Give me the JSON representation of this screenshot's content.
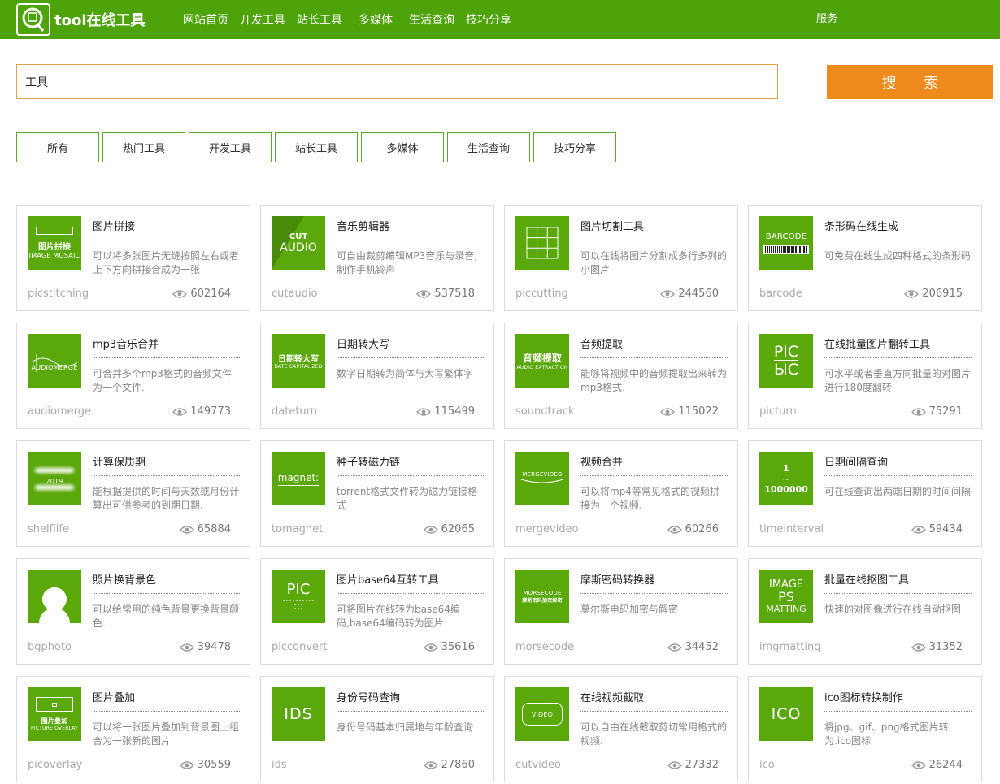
{
  "header": {
    "logo_text": "tool在线工具",
    "nav": [
      "网站首页",
      "开发工具",
      "站长工具",
      "多媒体",
      "生活查询",
      "技巧分享"
    ],
    "service": "服务",
    "bg_color": "#4ea20a"
  },
  "search": {
    "value": "工具",
    "button_label": "搜 索"
  },
  "filters": [
    "所有",
    "热门工具",
    "开发工具",
    "站长工具",
    "多媒体",
    "生活查询",
    "技巧分享"
  ],
  "cards": [
    {
      "title": "图片拼接",
      "desc": "可以将多张图片无缝按照左右或者上下方向拼接合成为一张",
      "slug": "picstitching",
      "views": "602164",
      "icon": "image-mosaic-icon",
      "thumb": [
        "图片拼接",
        "IMAGE MOSAIC"
      ]
    },
    {
      "title": "音乐剪辑器",
      "desc": "可自由裁剪编辑MP3音乐与录音,制作手机铃声",
      "slug": "cutaudio",
      "views": "537518",
      "icon": "cut-audio-icon",
      "thumb": [
        "CUT",
        "AUDIO"
      ]
    },
    {
      "title": "图片切割工具",
      "desc": "可以在线将图片分割成多行多列的小图片",
      "slug": "piccutting",
      "views": "244560",
      "icon": "grid-icon",
      "thumb": []
    },
    {
      "title": "条形码在线生成",
      "desc": "可免费在线生成四种格式的条形码",
      "slug": "barcode",
      "views": "206915",
      "icon": "barcode-icon",
      "thumb": [
        "BARCODE"
      ]
    },
    {
      "title": "mp3音乐合并",
      "desc": "可合并多个mp3格式的音频文件为一个文件.",
      "slug": "audiomerge",
      "views": "149773",
      "icon": "audio-merge-icon",
      "thumb": [
        "AUDIOMERGE"
      ]
    },
    {
      "title": "日期转大写",
      "desc": "数字日期转为简体与大写繁体字",
      "slug": "dateturn",
      "views": "115499",
      "icon": "date-capitalized-icon",
      "thumb": [
        "日期转大写",
        "DATE CAPITALIZED"
      ]
    },
    {
      "title": "音频提取",
      "desc": "能够将视频中的音频提取出来转为mp3格式.",
      "slug": "soundtrack",
      "views": "115022",
      "icon": "audio-extraction-icon",
      "thumb": [
        "音频提取",
        "AUDIO EXTRACTION"
      ]
    },
    {
      "title": "在线批量图片翻转工具",
      "desc": "可水平或者垂直方向批量的对图片进行180度翻转",
      "slug": "picturn",
      "views": "75291",
      "icon": "pic-flip-icon",
      "thumb": [
        "PIC",
        "ЫC"
      ]
    },
    {
      "title": "计算保质期",
      "desc": "能根据提供的时间与天数或月份计算出可供参考的到期日期.",
      "slug": "shelflife",
      "views": "65884",
      "icon": "shelflife-icon",
      "thumb": [
        "2019"
      ]
    },
    {
      "title": "种子转磁力链",
      "desc": "torrent格式文件转为磁力链接格式",
      "slug": "tomagnet",
      "views": "62065",
      "icon": "magnet-icon",
      "thumb": [
        "magnet:"
      ]
    },
    {
      "title": "视频合并",
      "desc": "可以将mp4等常见格式的视频拼接为一个视频.",
      "slug": "mergevideo",
      "views": "60266",
      "icon": "merge-video-icon",
      "thumb": [
        "MERGEVIDEO"
      ]
    },
    {
      "title": "日期间隔查询",
      "desc": "可在线查询出两端日期的时间间隔",
      "slug": "timeinterval",
      "views": "59434",
      "icon": "time-interval-icon",
      "thumb": [
        "1",
        "~",
        "1000000"
      ]
    },
    {
      "title": "照片换背景色",
      "desc": "可以给常用的纯色背景更换背景颜色.",
      "slug": "bgphoto",
      "views": "39478",
      "icon": "person-photo-icon",
      "thumb": []
    },
    {
      "title": "图片base64互转工具",
      "desc": "可将图片在线转为base64编码,base64编码转为图片",
      "slug": "picconvert",
      "views": "35616",
      "icon": "pic-base64-icon",
      "thumb": [
        "PIC"
      ]
    },
    {
      "title": "摩斯密码转换器",
      "desc": "莫尔斯电码加密与解密",
      "slug": "morsecode",
      "views": "34452",
      "icon": "morse-code-icon",
      "thumb": [
        "MORSECODE",
        "摩斯密码加密解密"
      ]
    },
    {
      "title": "批量在线抠图工具",
      "desc": "快速的对图像进行在线自动抠图",
      "slug": "imgmatting",
      "views": "31352",
      "icon": "ps-matting-icon",
      "thumb": [
        "IMAGE",
        "PS",
        "MATTING"
      ]
    },
    {
      "title": "图片叠加",
      "desc": "可以将一张图片叠加到背景图上组合为一张新的图片",
      "slug": "picoverlay",
      "views": "30559",
      "icon": "picture-overlay-icon",
      "thumb": [
        "图片叠加",
        "PICTURE OVERLAY"
      ]
    },
    {
      "title": "身份号码查询",
      "desc": "身份号码基本归属地与年龄查询",
      "slug": "ids",
      "views": "27860",
      "icon": "ids-icon",
      "thumb": [
        "IDS"
      ]
    },
    {
      "title": "在线视频截取",
      "desc": "可以自由在线截取剪切常用格式的视频.",
      "slug": "cutvideo",
      "views": "27332",
      "icon": "video-cut-icon",
      "thumb": [
        "VIDEO"
      ]
    },
    {
      "title": "ico图标转换制作",
      "desc": "将jpg、gif、png格式图片转为.ico图标",
      "slug": "ico",
      "views": "26244",
      "icon": "ico-icon",
      "thumb": [
        "ICO"
      ]
    }
  ]
}
